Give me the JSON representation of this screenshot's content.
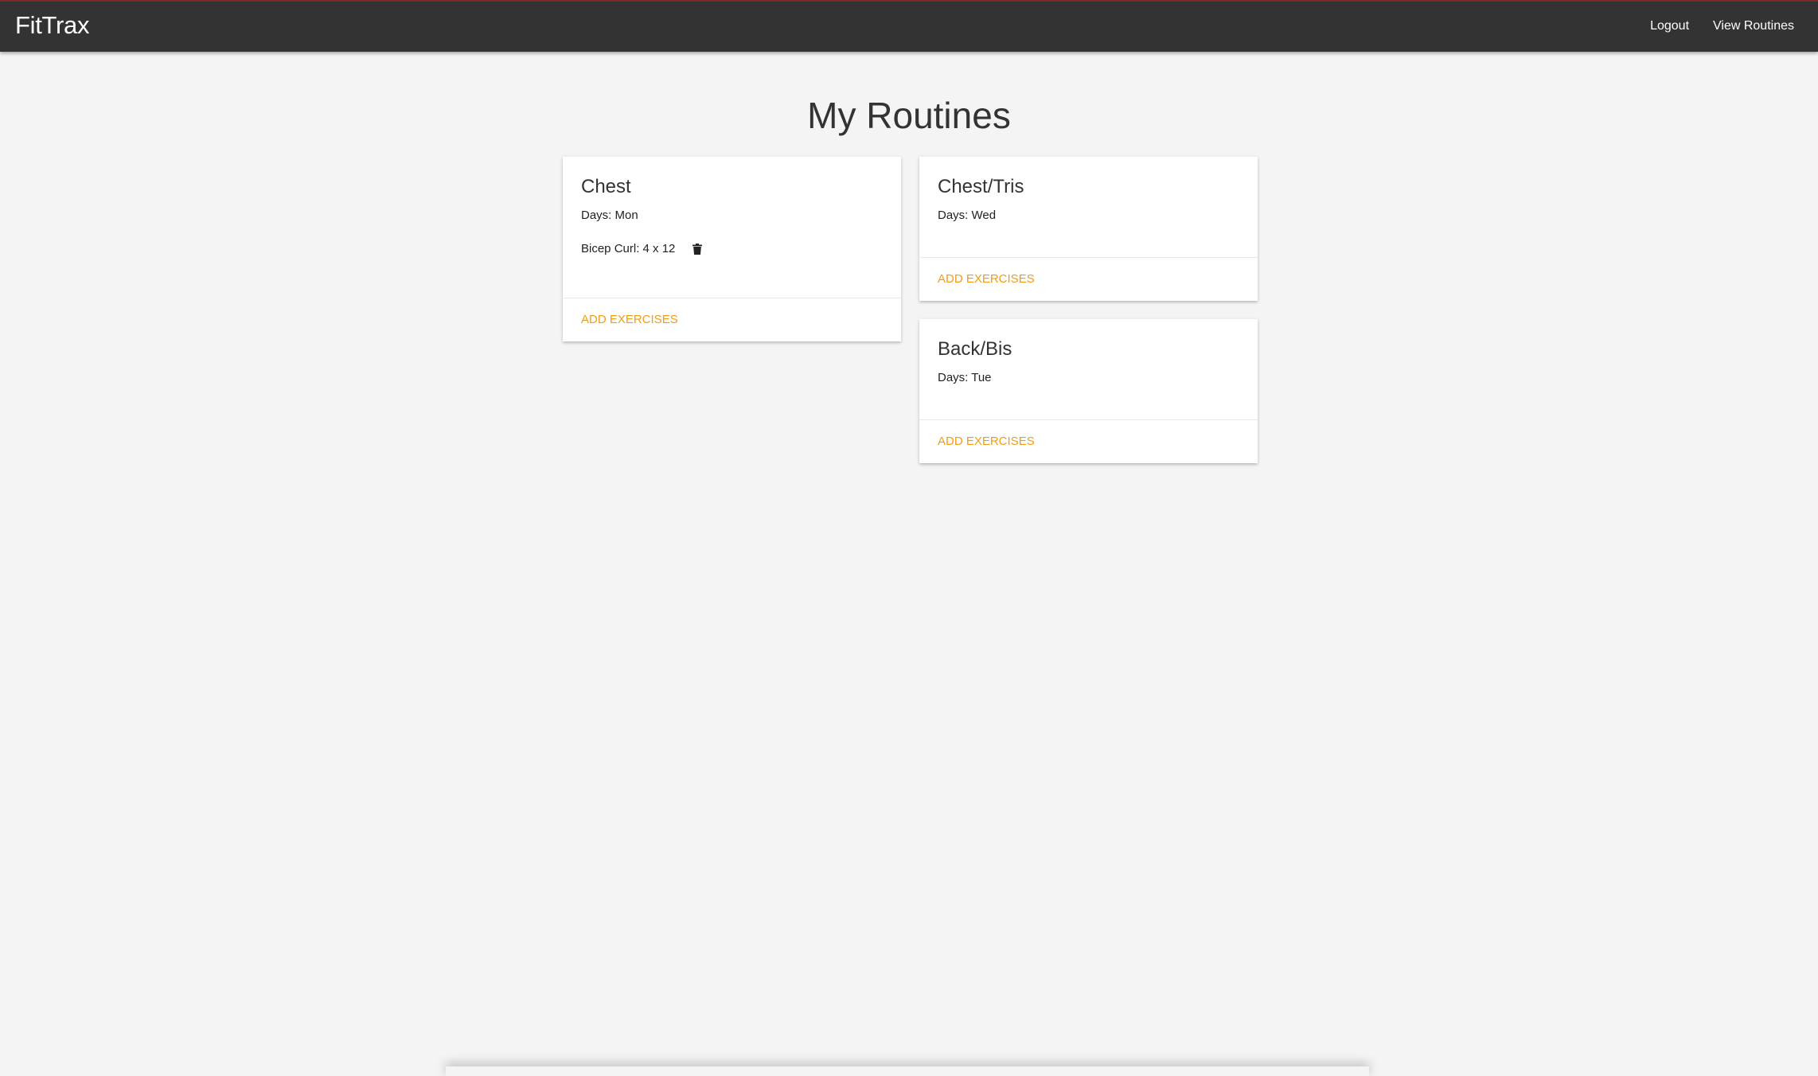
{
  "app": {
    "brand": "FitTrax",
    "nav": [
      {
        "label": "Logout"
      },
      {
        "label": "View Routines"
      }
    ]
  },
  "page": {
    "title": "My Routines"
  },
  "routines": [
    {
      "name": "Chest",
      "days": "Days: Mon",
      "exercises": [
        {
          "label": "Bicep Curl: 4 x 12",
          "icon": "trash-icon"
        }
      ],
      "action_label": "ADD EXERCISES"
    },
    {
      "name": "Chest/Tris",
      "days": "Days: Wed",
      "exercises": [],
      "action_label": "ADD EXERCISES"
    },
    {
      "name": "Back/Bis",
      "days": "Days: Tue",
      "exercises": [],
      "action_label": "ADD EXERCISES"
    }
  ],
  "colors": {
    "navbar": "#333333",
    "background": "#f4f4f4",
    "accent": "#f39c12"
  }
}
